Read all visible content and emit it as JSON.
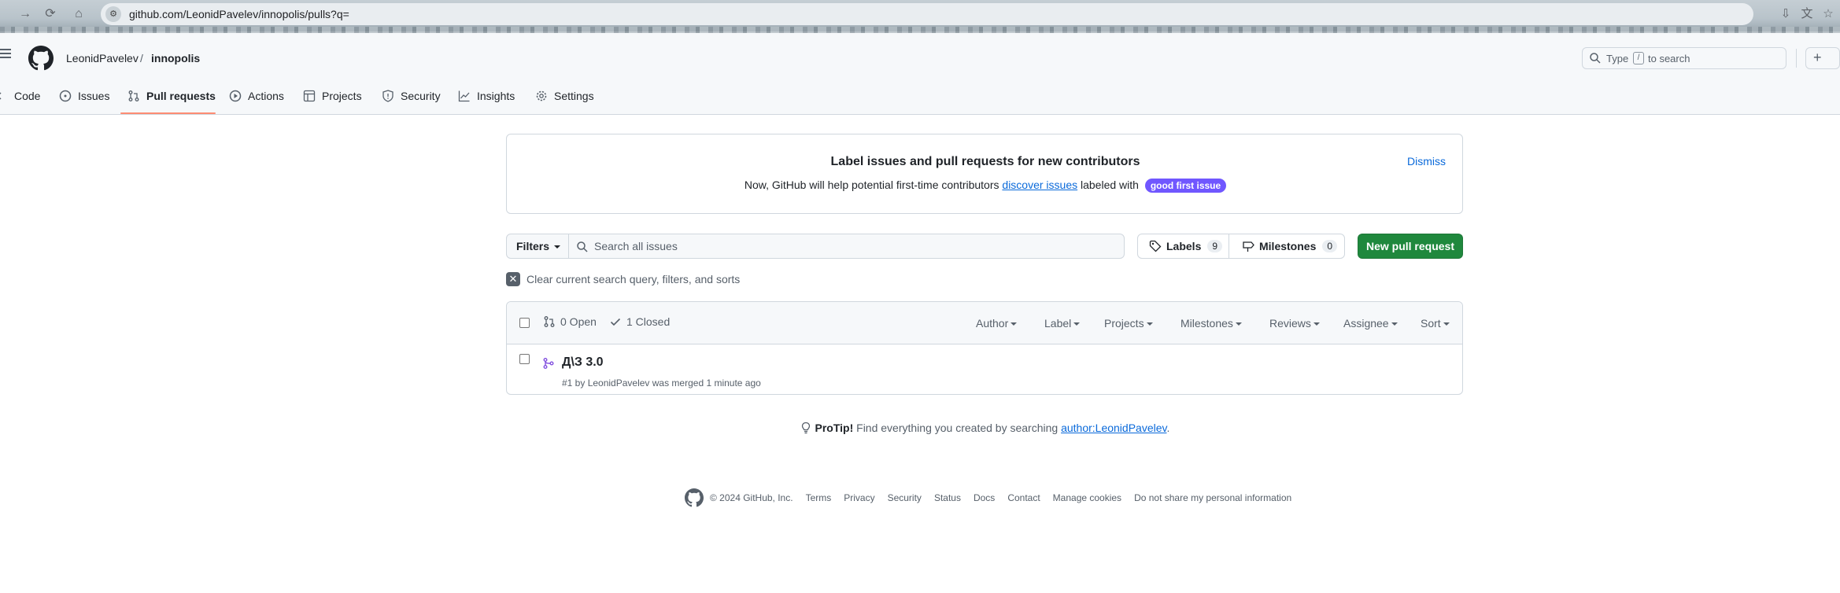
{
  "browser": {
    "url": "github.com/LeonidPavelev/innopolis/pulls?q=",
    "back_icon": "arrow-left-icon",
    "forward_icon": "arrow-right-icon",
    "reload_icon": "reload-icon",
    "home_icon": "home-icon"
  },
  "header": {
    "owner": "LeonidPavelev",
    "separator": "/",
    "repo": "innopolis",
    "search_prefix": "Type",
    "search_key": "/",
    "search_suffix": "to search",
    "plus_label": "+"
  },
  "tabs": [
    {
      "label": "Code",
      "icon": "code-icon"
    },
    {
      "label": "Issues",
      "icon": "issue-opened-icon"
    },
    {
      "label": "Pull requests",
      "icon": "git-pull-request-icon",
      "active": true
    },
    {
      "label": "Actions",
      "icon": "play-icon"
    },
    {
      "label": "Projects",
      "icon": "table-icon"
    },
    {
      "label": "Security",
      "icon": "shield-icon"
    },
    {
      "label": "Insights",
      "icon": "graph-icon"
    },
    {
      "label": "Settings",
      "icon": "gear-icon"
    }
  ],
  "banner": {
    "title": "Label issues and pull requests for new contributors",
    "text_before": "Now, GitHub will help potential first-time contributors",
    "link": "discover issues",
    "text_after": "labeled with",
    "label": "good first issue",
    "label_color": "#7057ff",
    "dismiss": "Dismiss"
  },
  "filterbar": {
    "filters_label": "Filters",
    "search_placeholder": "Search all issues",
    "labels_label": "Labels",
    "labels_count": "9",
    "milestones_label": "Milestones",
    "milestones_count": "0",
    "new_pr_label": "New pull request",
    "new_pr_color": "#1f883d"
  },
  "clear_query": "Clear current search query, filters, and sorts",
  "list": {
    "open_label": "0 Open",
    "closed_label": "1 Closed",
    "filters": [
      "Author",
      "Label",
      "Projects",
      "Milestones",
      "Reviews",
      "Assignee",
      "Sort"
    ],
    "rows": [
      {
        "title": "Д\\З 3.0",
        "meta": "#1 by LeonidPavelev was merged 1 minute ago",
        "state_icon": "git-merge-icon",
        "state_color": "#8250df"
      }
    ]
  },
  "protip": {
    "bold": "ProTip!",
    "text": "Find everything you created by searching",
    "link": "author:LeonidPavelev",
    "end": "."
  },
  "footer": {
    "copyright": "© 2024 GitHub, Inc.",
    "links": [
      "Terms",
      "Privacy",
      "Security",
      "Status",
      "Docs",
      "Contact",
      "Manage cookies",
      "Do not share my personal information"
    ]
  }
}
